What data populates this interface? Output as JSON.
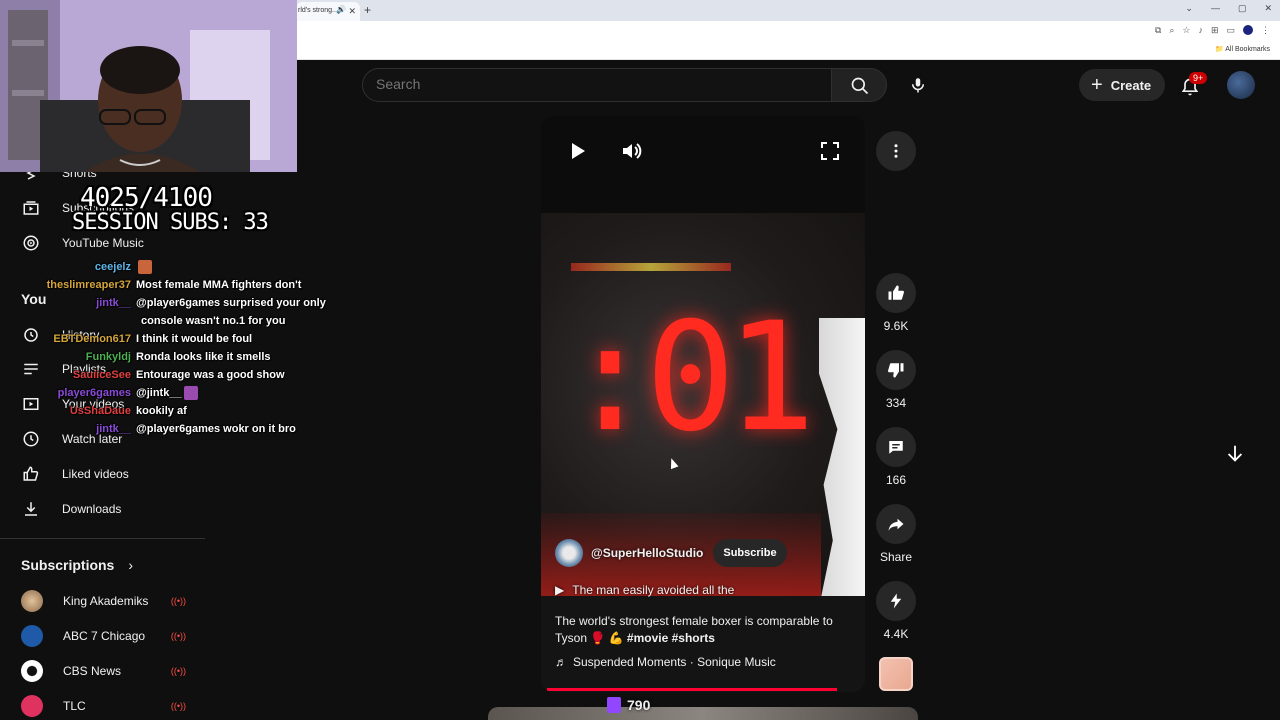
{
  "browser": {
    "tab_title": "rld's strong...",
    "bookmarks_label": "All Bookmarks"
  },
  "header": {
    "search_placeholder": "Search",
    "create_label": "Create",
    "notifications_badge": "9+"
  },
  "overlay": {
    "sub_counter": "4025/4100",
    "session_subs": "SESSION SUBS: 33",
    "viewer_count": "790"
  },
  "sidebar": {
    "items": [
      {
        "label": "Shorts",
        "icon": "shorts-icon"
      },
      {
        "label": "Subscriptions",
        "icon": "subscriptions-icon"
      },
      {
        "label": "YouTube Music",
        "icon": "music-icon"
      }
    ],
    "you_label": "You",
    "you_items": [
      {
        "label": "History",
        "icon": "history-icon"
      },
      {
        "label": "Playlists",
        "icon": "playlists-icon"
      },
      {
        "label": "Your videos",
        "icon": "your-videos-icon"
      },
      {
        "label": "Watch later",
        "icon": "clock-icon"
      },
      {
        "label": "Liked videos",
        "icon": "thumbs-up-icon"
      },
      {
        "label": "Downloads",
        "icon": "download-icon"
      }
    ],
    "subscriptions_label": "Subscriptions",
    "subscriptions": [
      {
        "name": "King Akademiks",
        "color": "#c7a27a"
      },
      {
        "name": "ABC 7 Chicago",
        "color": "#1e5aa8"
      },
      {
        "name": "CBS News",
        "color": "#ffffff"
      },
      {
        "name": "TLC",
        "color": "#e0325f"
      }
    ]
  },
  "chat": [
    {
      "user": "ceejelz",
      "color": "#5fb4e8",
      "msg": ""
    },
    {
      "user": "theslimreaper37",
      "color": "#d4a53a",
      "msg": "Most female MMA fighters don't"
    },
    {
      "user": "jintk__",
      "color": "#8a4bd8",
      "msg": "@player6games surprised your only"
    },
    {
      "user": "",
      "color": "#ffffff",
      "msg": "console wasn't no.1 for you"
    },
    {
      "user": "EBTDemon617",
      "color": "#d4a53a",
      "msg": "I think it would be foul"
    },
    {
      "user": "Funkyldj",
      "color": "#4caf50",
      "msg": "Ronda looks like it smells"
    },
    {
      "user": "SauiiceSee",
      "color": "#e04040",
      "msg": "Entourage was a good show"
    },
    {
      "user": "player6games",
      "color": "#8a4bd8",
      "msg": "@jintk__"
    },
    {
      "user": "UsShaDaue",
      "color": "#e04040",
      "msg": "kookily af"
    },
    {
      "user": "jintk__",
      "color": "#8a4bd8",
      "msg": "@player6games wokr on it bro"
    }
  ],
  "short": {
    "timer_digits": ":01",
    "channel": "@SuperHelloStudio",
    "subscribe_label": "Subscribe",
    "teaser": "The man easily avoided all the",
    "title_plain": "The world's strongest female boxer is comparable to Tyson 🥊 💪",
    "title_tags": "#movie #shorts",
    "music": "Suspended Moments · Sonique Music",
    "progress": 0.93
  },
  "actions": {
    "likes": "9.6K",
    "dislikes": "334",
    "comments": "166",
    "share": "Share",
    "remix": "4.4K"
  }
}
